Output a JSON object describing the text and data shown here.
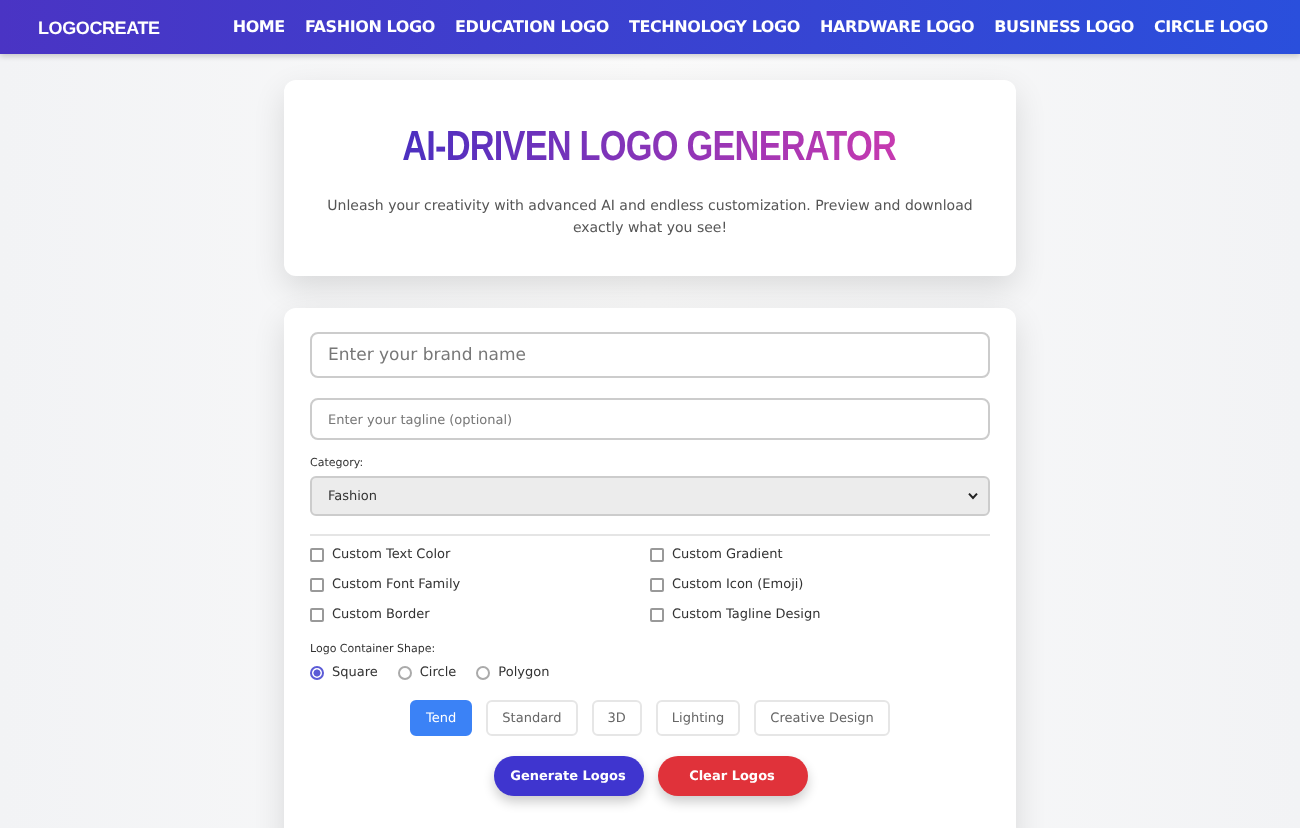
{
  "nav": {
    "brand": "LOGOCREATE",
    "links": [
      "HOME",
      "FASHION LOGO",
      "EDUCATION LOGO",
      "TECHNOLOGY LOGO",
      "HARDWARE LOGO",
      "BUSINESS LOGO",
      "CIRCLE LOGO"
    ]
  },
  "hero": {
    "title": "AI-DRIVEN LOGO GENERATOR",
    "subtitle": "Unleash your creativity with advanced AI and endless customization. Preview and download exactly what you see!"
  },
  "form": {
    "brand_field": {
      "placeholder": "Enter your brand name"
    },
    "tagline_field": {
      "placeholder": "Enter your tagline (optional)"
    },
    "category": {
      "label": "Category:",
      "value": "Fashion"
    },
    "options": [
      {
        "label": "Custom Text Color",
        "checked": false
      },
      {
        "label": "Custom Gradient",
        "checked": false
      },
      {
        "label": "Custom Font Family",
        "checked": false
      },
      {
        "label": "Custom Icon (Emoji)",
        "checked": false
      },
      {
        "label": "Custom Border",
        "checked": false
      },
      {
        "label": "Custom Tagline Design",
        "checked": false
      }
    ],
    "shape": {
      "label": "Logo Container Shape:",
      "choices": [
        {
          "label": "Square",
          "selected": true
        },
        {
          "label": "Circle",
          "selected": false
        },
        {
          "label": "Polygon",
          "selected": false
        }
      ]
    },
    "styles": [
      {
        "label": "Tend",
        "selected": true
      },
      {
        "label": "Standard",
        "selected": false
      },
      {
        "label": "3D",
        "selected": false
      },
      {
        "label": "Lighting",
        "selected": false
      },
      {
        "label": "Creative Design",
        "selected": false
      }
    ],
    "actions": [
      {
        "label": "Generate Logos",
        "kind": "primary"
      },
      {
        "label": "Clear Logos",
        "kind": "danger"
      }
    ]
  }
}
